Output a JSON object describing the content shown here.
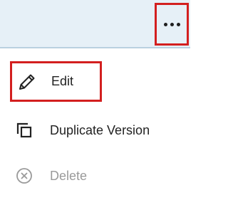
{
  "header": {
    "more_button_icon": "more-horizontal-icon"
  },
  "menu": {
    "items": [
      {
        "label": "Edit",
        "icon": "pencil-icon",
        "highlighted": true,
        "disabled": false
      },
      {
        "label": "Duplicate Version",
        "icon": "duplicate-icon",
        "highlighted": false,
        "disabled": false
      },
      {
        "label": "Delete",
        "icon": "close-circle-icon",
        "highlighted": false,
        "disabled": true
      }
    ]
  },
  "colors": {
    "header_background": "#e6f0f7",
    "highlight_border": "#d31f1f",
    "text": "#222222",
    "disabled_text": "#9a9a9a"
  }
}
